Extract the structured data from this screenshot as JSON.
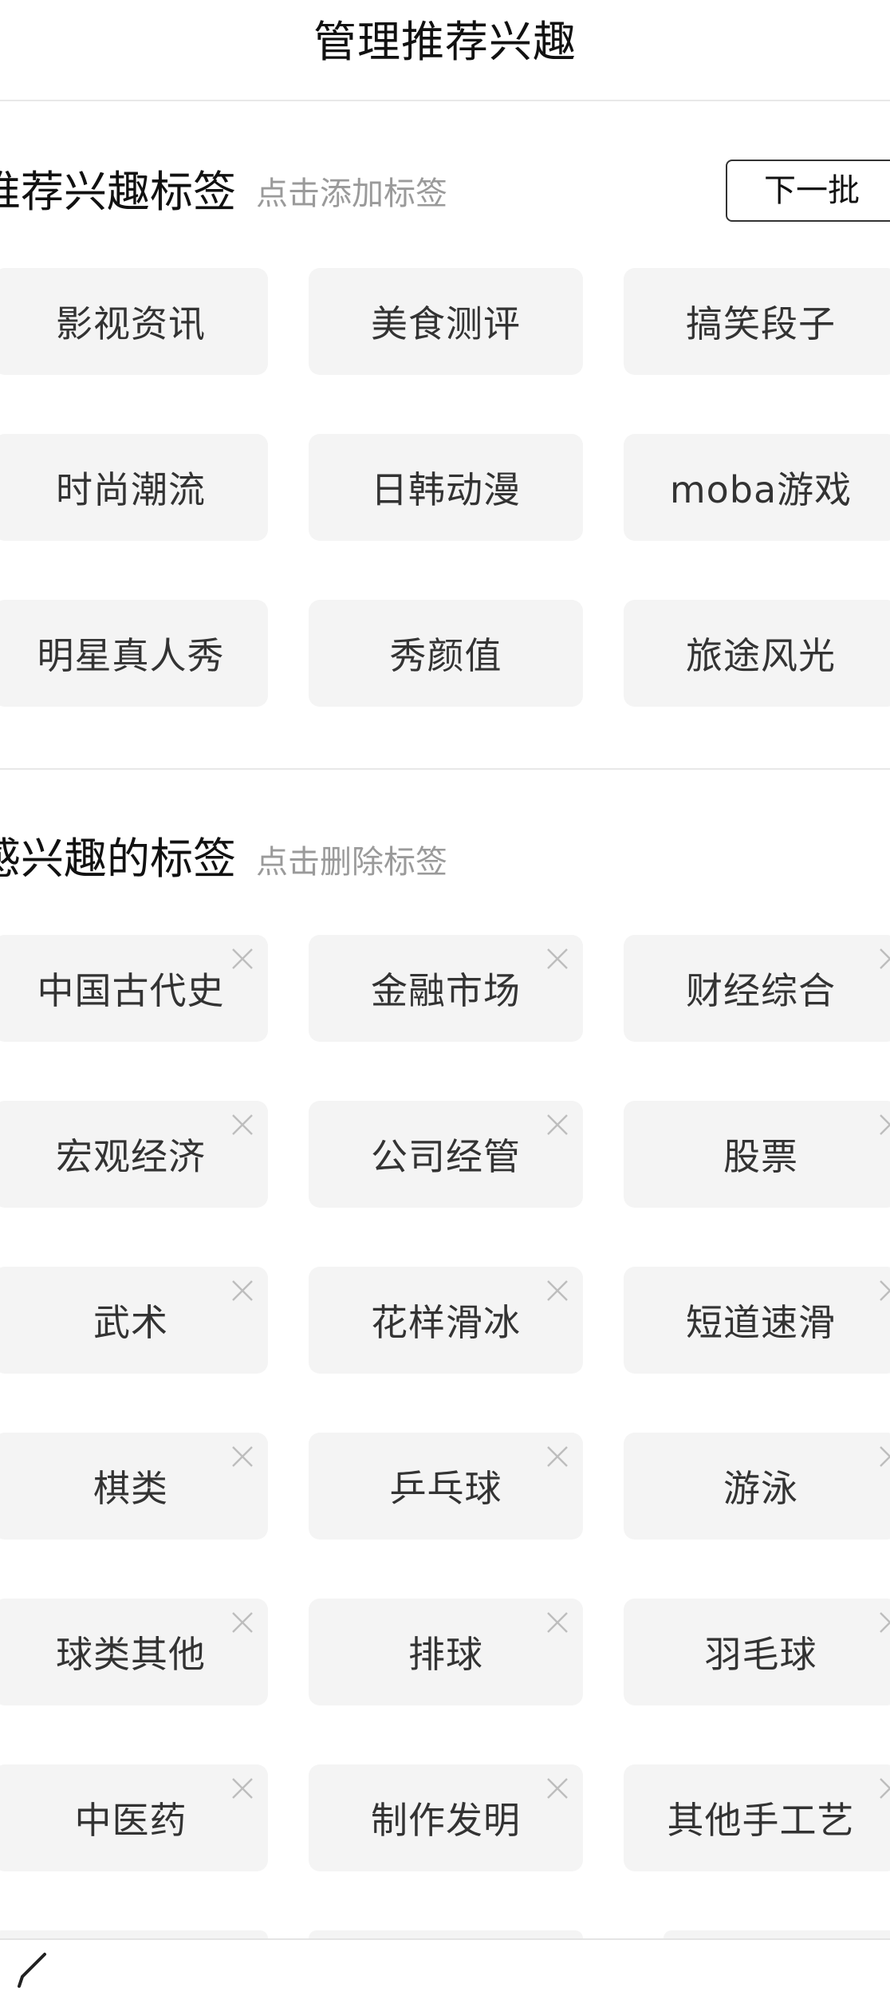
{
  "header": {
    "title": "管理推荐兴趣"
  },
  "recommended": {
    "title": "推荐兴趣标签",
    "hint": "点击添加标签",
    "next_label": "下一批",
    "tags": [
      "影视资讯",
      "美食测评",
      "搞笑段子",
      "时尚潮流",
      "日韩动漫",
      "moba游戏",
      "明星真人秀",
      "秀颜值",
      "旅途风光"
    ]
  },
  "interested": {
    "title": "感兴趣的标签",
    "hint": "点击删除标签",
    "tags": [
      "中国古代史",
      "金融市场",
      "财经综合",
      "宏观经济",
      "公司经管",
      "股票",
      "武术",
      "花样滑冰",
      "短道速滑",
      "棋类",
      "乒乓球",
      "游泳",
      "球类其他",
      "排球",
      "羽毛球",
      "中医药",
      "制作发明",
      "其他手工艺"
    ]
  },
  "icons": {
    "remove": "close-icon",
    "edit": "pencil-icon"
  },
  "colors": {
    "tag_background": "#f4f4f4",
    "tag_text": "#333333",
    "hint_text": "#9a9a9a",
    "divider": "#e8e8e8"
  }
}
